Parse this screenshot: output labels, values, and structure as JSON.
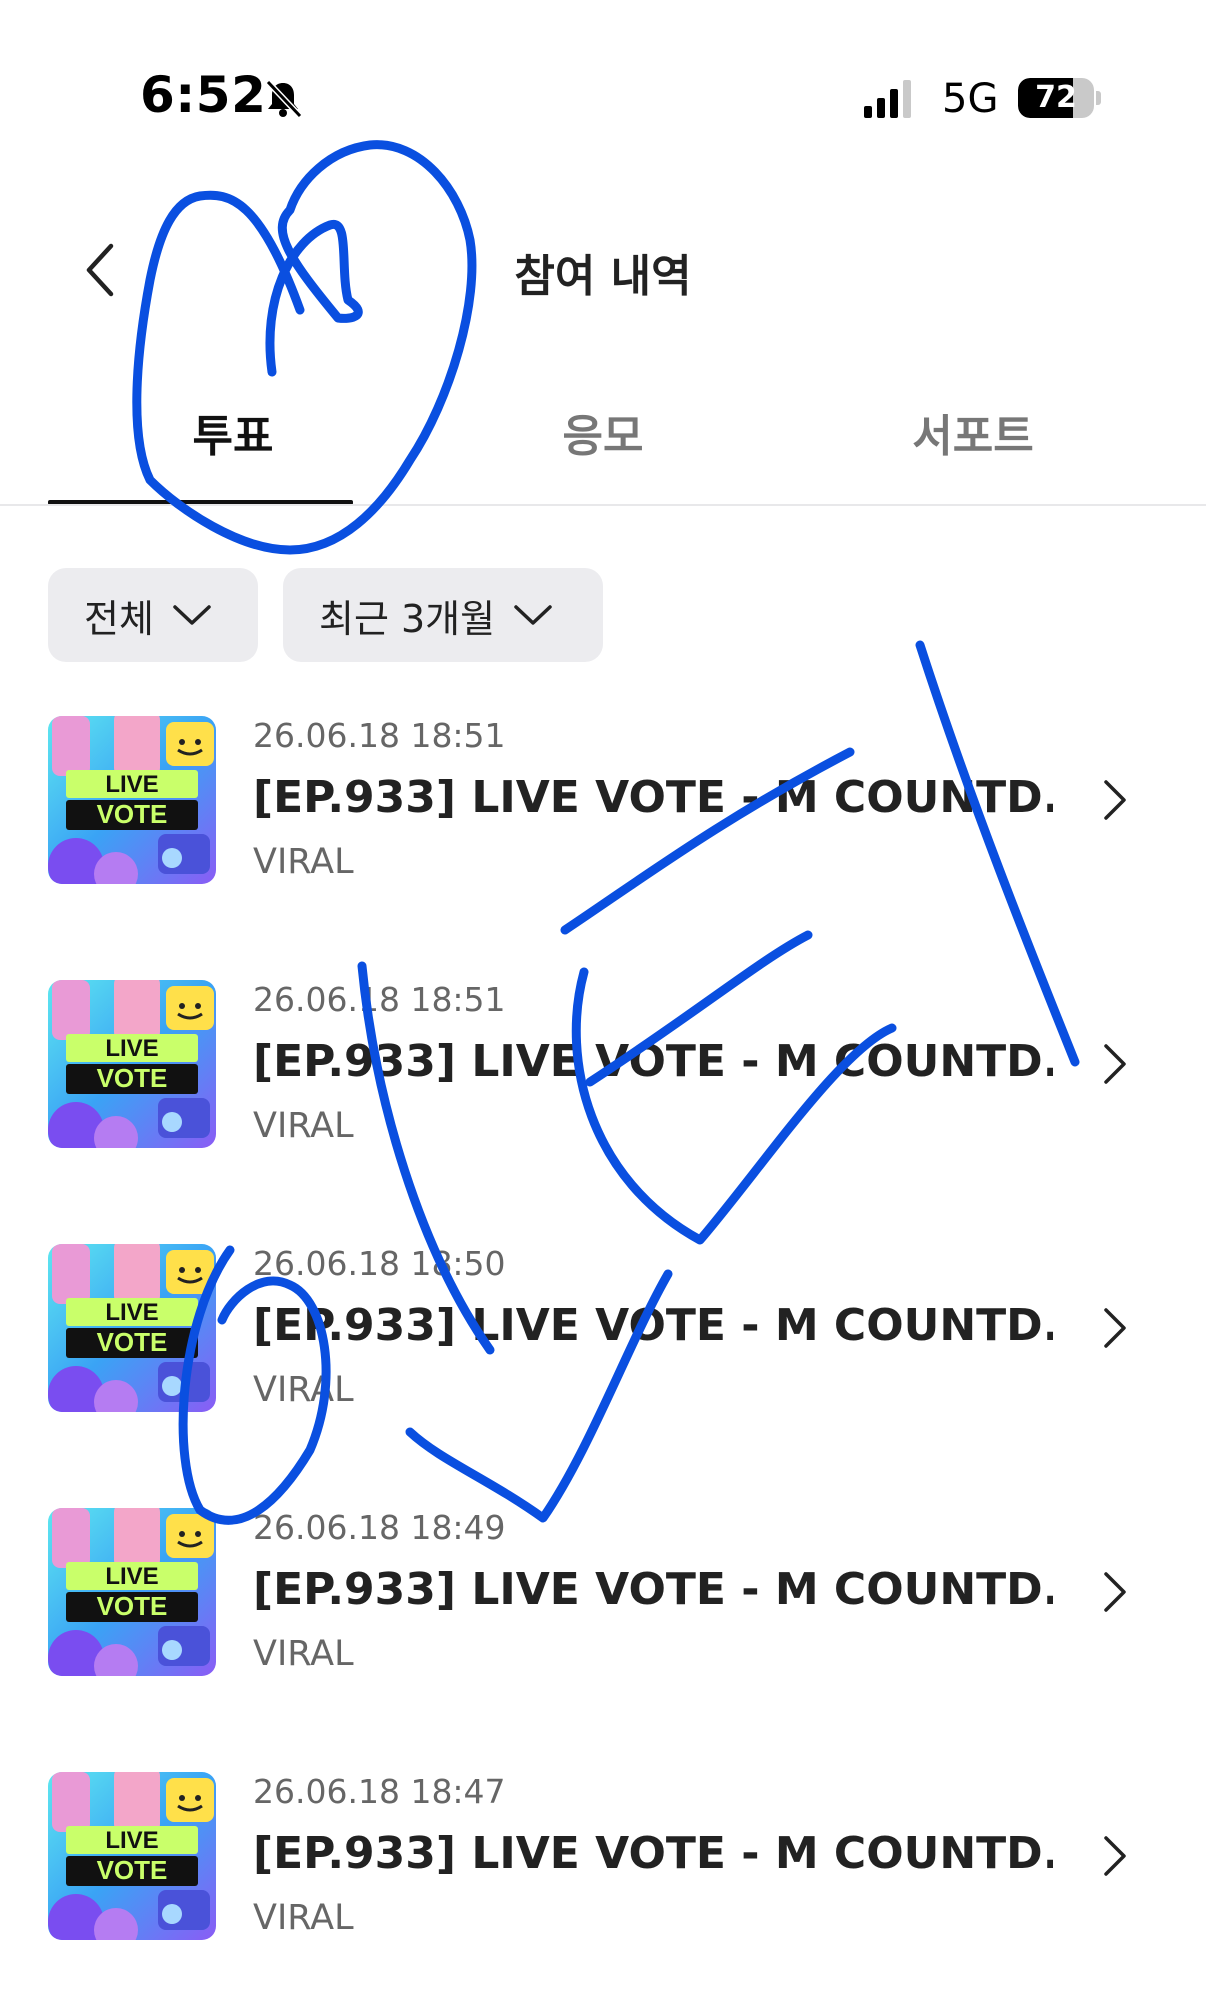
{
  "status_bar": {
    "time": "6:52",
    "network": "5G",
    "battery": "72",
    "battery_level": 0.72,
    "bell_icon": "bell-slash-icon",
    "signal_icon": "cellular-signal-icon"
  },
  "header": {
    "title": "참여 내역",
    "back_icon": "chevron-left-icon"
  },
  "tabs": [
    {
      "label": "투표",
      "active": true
    },
    {
      "label": "응모",
      "active": false
    },
    {
      "label": "서포트",
      "active": false
    }
  ],
  "filters": [
    {
      "label": "전체",
      "icon": "chevron-down-icon"
    },
    {
      "label": "최근 3개월",
      "icon": "chevron-down-icon"
    }
  ],
  "items": [
    {
      "date": "26.06.18 18:51",
      "title": "[EP.933] LIVE VOTE - M COUNTD...",
      "subtitle": "VIRAL",
      "thumb_line1": "LIVE",
      "thumb_line2": "VOTE"
    },
    {
      "date": "26.06.18 18:51",
      "title": "[EP.933] LIVE VOTE - M COUNTD...",
      "subtitle": "VIRAL",
      "thumb_line1": "LIVE",
      "thumb_line2": "VOTE"
    },
    {
      "date": "26.06.18 18:50",
      "title": "[EP.933] LIVE VOTE - M COUNTD...",
      "subtitle": "VIRAL",
      "thumb_line1": "LIVE",
      "thumb_line2": "VOTE"
    },
    {
      "date": "26.06.18 18:49",
      "title": "[EP.933] LIVE VOTE - M COUNTD...",
      "subtitle": "VIRAL",
      "thumb_line1": "LIVE",
      "thumb_line2": "VOTE"
    },
    {
      "date": "26.06.18 18:47",
      "title": "[EP.933] LIVE VOTE - M COUNTD...",
      "subtitle": "VIRAL",
      "thumb_line1": "LIVE",
      "thumb_line2": "VOTE"
    }
  ],
  "colors": {
    "accent_text": "#111111",
    "muted_text": "#666666",
    "filter_bg": "#ececef",
    "annotation": "#0a4fe0"
  }
}
